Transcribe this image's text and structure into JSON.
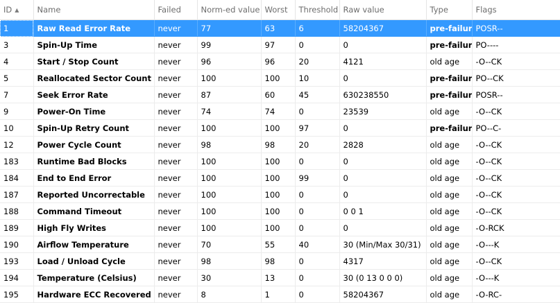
{
  "columns": [
    "ID",
    "Name",
    "Failed",
    "Norm-ed value",
    "Worst",
    "Threshold",
    "Raw value",
    "Type",
    "Flags"
  ],
  "sort_icon": "sort-ascending-icon",
  "rows": [
    {
      "id": "1",
      "name": "Raw Read Error Rate",
      "failed": "never",
      "value": "77",
      "worst": "63",
      "threshold": "6",
      "raw": "58204367",
      "type": "pre-failure",
      "flags": "POSR--"
    },
    {
      "id": "3",
      "name": "Spin-Up Time",
      "failed": "never",
      "value": "99",
      "worst": "97",
      "threshold": "0",
      "raw": "0",
      "type": "pre-failure",
      "flags": "PO----"
    },
    {
      "id": "4",
      "name": "Start / Stop Count",
      "failed": "never",
      "value": "96",
      "worst": "96",
      "threshold": "20",
      "raw": "4121",
      "type": "old age",
      "flags": "-O--CK"
    },
    {
      "id": "5",
      "name": "Reallocated Sector Count",
      "failed": "never",
      "value": "100",
      "worst": "100",
      "threshold": "10",
      "raw": "0",
      "type": "pre-failure",
      "flags": "PO--CK"
    },
    {
      "id": "7",
      "name": "Seek Error Rate",
      "failed": "never",
      "value": "87",
      "worst": "60",
      "threshold": "45",
      "raw": "630238550",
      "type": "pre-failure",
      "flags": "POSR--"
    },
    {
      "id": "9",
      "name": "Power-On Time",
      "failed": "never",
      "value": "74",
      "worst": "74",
      "threshold": "0",
      "raw": "23539",
      "type": "old age",
      "flags": "-O--CK"
    },
    {
      "id": "10",
      "name": "Spin-Up Retry Count",
      "failed": "never",
      "value": "100",
      "worst": "100",
      "threshold": "97",
      "raw": "0",
      "type": "pre-failure",
      "flags": "PO--C-"
    },
    {
      "id": "12",
      "name": "Power Cycle Count",
      "failed": "never",
      "value": "98",
      "worst": "98",
      "threshold": "20",
      "raw": "2828",
      "type": "old age",
      "flags": "-O--CK"
    },
    {
      "id": "183",
      "name": "Runtime Bad Blocks",
      "failed": "never",
      "value": "100",
      "worst": "100",
      "threshold": "0",
      "raw": "0",
      "type": "old age",
      "flags": "-O--CK"
    },
    {
      "id": "184",
      "name": "End to End Error",
      "failed": "never",
      "value": "100",
      "worst": "100",
      "threshold": "99",
      "raw": "0",
      "type": "old age",
      "flags": "-O--CK"
    },
    {
      "id": "187",
      "name": "Reported Uncorrectable",
      "failed": "never",
      "value": "100",
      "worst": "100",
      "threshold": "0",
      "raw": "0",
      "type": "old age",
      "flags": "-O--CK"
    },
    {
      "id": "188",
      "name": "Command Timeout",
      "failed": "never",
      "value": "100",
      "worst": "100",
      "threshold": "0",
      "raw": "0 0 1",
      "type": "old age",
      "flags": "-O--CK"
    },
    {
      "id": "189",
      "name": "High Fly Writes",
      "failed": "never",
      "value": "100",
      "worst": "100",
      "threshold": "0",
      "raw": "0",
      "type": "old age",
      "flags": "-O-RCK"
    },
    {
      "id": "190",
      "name": "Airflow Temperature",
      "failed": "never",
      "value": "70",
      "worst": "55",
      "threshold": "40",
      "raw": "30 (Min/Max 30/31)",
      "type": "old age",
      "flags": "-O---K"
    },
    {
      "id": "193",
      "name": "Load / Unload Cycle",
      "failed": "never",
      "value": "98",
      "worst": "98",
      "threshold": "0",
      "raw": "4317",
      "type": "old age",
      "flags": "-O--CK"
    },
    {
      "id": "194",
      "name": "Temperature (Celsius)",
      "failed": "never",
      "value": "30",
      "worst": "13",
      "threshold": "0",
      "raw": "30 (0 13 0 0 0)",
      "type": "old age",
      "flags": "-O---K"
    },
    {
      "id": "195",
      "name": "Hardware ECC Recovered",
      "failed": "never",
      "value": "8",
      "worst": "1",
      "threshold": "0",
      "raw": "58204367",
      "type": "old age",
      "flags": "-O-RC-"
    }
  ],
  "selected_row_index": 0,
  "colors": {
    "selection": "#3399ff",
    "header_text": "#6d6d6d",
    "grid": "#ececec"
  }
}
